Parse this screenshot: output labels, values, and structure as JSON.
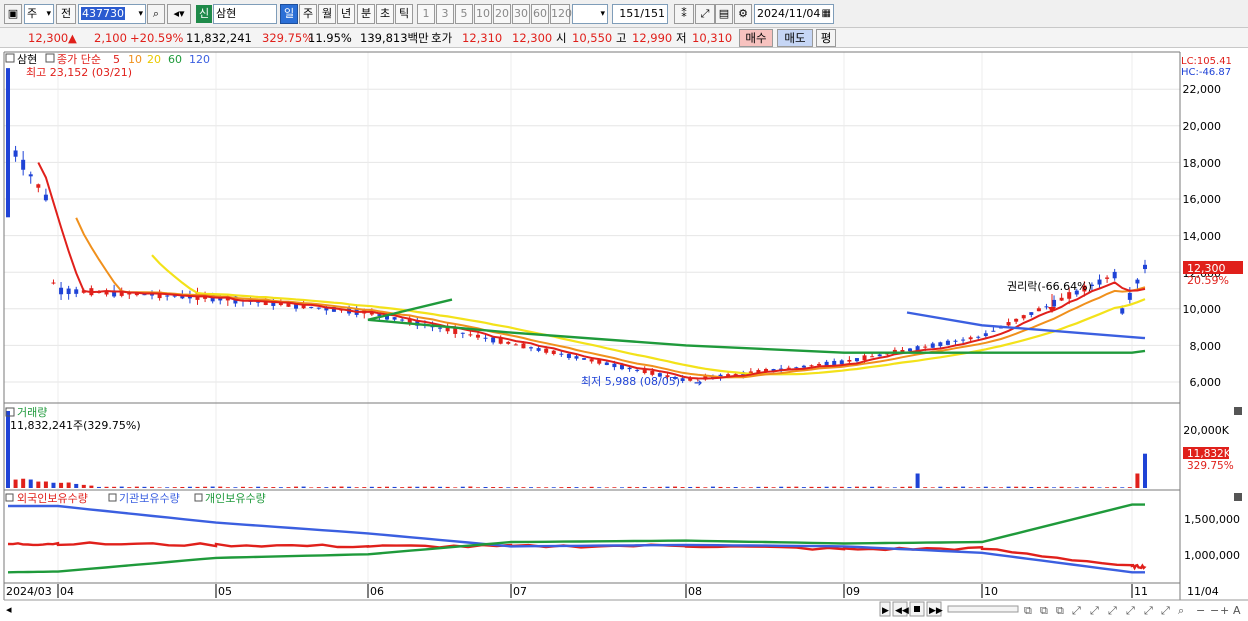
{
  "toolbar": {
    "market": "주",
    "prev_label": "전",
    "code": "437730",
    "badge": "신",
    "name": "삼현",
    "periods": [
      "일",
      "주",
      "월",
      "년",
      "분",
      "초",
      "틱"
    ],
    "active_period": "일",
    "minutes": [
      "1",
      "3",
      "5",
      "10",
      "20",
      "30",
      "60",
      "120"
    ],
    "count": "151",
    "total": "/151",
    "date": "2024/11/04"
  },
  "quote": {
    "price": "12,300",
    "change": "2,100",
    "rate": "+20.59%",
    "volume": "11,832,241",
    "vol_rate": "329.75%",
    "turnover": "11.95%",
    "amount": "139,813백만",
    "bid_label": "호가",
    "bid1": "12,310",
    "bid2": "12,300",
    "open_label": "시",
    "open": "10,550",
    "high_label": "고",
    "high": "12,990",
    "low_label": "저",
    "low": "10,310",
    "buy_label": "매수",
    "sell_label": "매도",
    "eval_label": "평"
  },
  "price_panel": {
    "stock_label": "삼현",
    "ma_title": "종가 단순",
    "ma_periods": [
      "5",
      "10",
      "20",
      "60",
      "120"
    ],
    "high_note": "최고 23,152 (03/21)",
    "low_note": "최저 5,988 (08/05)",
    "event_note": "권리락(-66.64%)",
    "lc": "LC:105.41",
    "hc": "HC:-46.87",
    "y_ticks": [
      "22,000",
      "20,000",
      "18,000",
      "16,000",
      "14,000",
      "12,000",
      "10,000",
      "8,000",
      "6,000"
    ],
    "last_price": "12,300",
    "last_rate": "20.59%"
  },
  "volume_panel": {
    "title": "거래량",
    "value": "11,832,241주(329.75%)",
    "y_ticks": [
      "20,000K"
    ],
    "last": "11,832K",
    "last_rate": "329.75%"
  },
  "holdings_panel": {
    "series": [
      "외국인보유수량",
      "기관보유수량",
      "개인보유수량"
    ],
    "y_ticks": [
      "1,500,000",
      "1,000,000"
    ]
  },
  "x_axis": {
    "labels": [
      "2024/03",
      "04",
      "05",
      "06",
      "07",
      "08",
      "09",
      "10",
      "11"
    ],
    "right_label": "11/04"
  },
  "colors": {
    "up": "#e0201b",
    "down": "#1f43d6",
    "ma5": "#e0201b",
    "ma10": "#f0901c",
    "ma20": "#f3e21a",
    "ma60": "#1f9a3b",
    "ma120": "#3b5fe0"
  },
  "chart_data": [
    {
      "type": "line",
      "title": "삼현 일봉",
      "x": [
        "2024/03",
        "04",
        "05",
        "06",
        "07",
        "08",
        "09",
        "10",
        "11"
      ],
      "series": [
        {
          "name": "종가",
          "values": [
            15500,
            11000,
            10600,
            9800,
            8100,
            6100,
            7100,
            8500,
            12300
          ]
        },
        {
          "name": "120",
          "values": [
            null,
            null,
            null,
            null,
            null,
            null,
            null,
            9800,
            8400
          ]
        },
        {
          "name": "60",
          "values": [
            null,
            null,
            10500,
            9400,
            8700,
            8000,
            7600,
            7600,
            7600
          ]
        }
      ],
      "ylim": [
        5000,
        23500
      ]
    },
    {
      "type": "bar",
      "title": "거래량",
      "categories": [
        "2024/11/04"
      ],
      "values": [
        11832241
      ]
    },
    {
      "type": "line",
      "title": "보유수량",
      "x": [
        "2024/03",
        "04",
        "05",
        "06",
        "07",
        "08",
        "09",
        "10",
        "11"
      ],
      "series": [
        {
          "name": "외국인보유수량",
          "values": [
            1150000,
            1160000,
            1140000,
            1120000,
            1120000,
            1130000,
            1080000,
            1090000,
            840000
          ]
        },
        {
          "name": "기관보유수량",
          "values": [
            1680000,
            1680000,
            1450000,
            1300000,
            1120000,
            1140000,
            1120000,
            1030000,
            760000
          ]
        },
        {
          "name": "개인보유수량",
          "values": [
            760000,
            770000,
            960000,
            1010000,
            1180000,
            1200000,
            1160000,
            1180000,
            1700000
          ]
        }
      ],
      "ylim": [
        700000,
        1800000
      ]
    }
  ]
}
